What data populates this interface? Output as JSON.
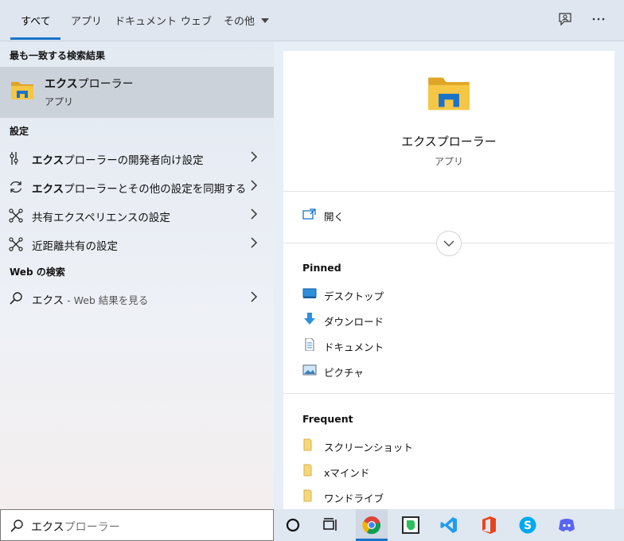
{
  "tabs": [
    {
      "label": "すべて"
    },
    {
      "label": "アプリ"
    },
    {
      "label": "ドキュメント"
    },
    {
      "label": "ウェブ"
    },
    {
      "label": "その他"
    }
  ],
  "left": {
    "best_match_heading": "最も一致する検索結果",
    "best_match": {
      "title_bold": "エクス",
      "title_rest": "プローラー",
      "subtitle": "アプリ"
    },
    "settings_heading": "設定",
    "settings": [
      {
        "bold": "エクス",
        "rest": "プローラーの開発者向け設定"
      },
      {
        "bold": "エクス",
        "rest": "プローラーとその他の設定を同期する"
      },
      {
        "bold": "",
        "rest": "共有エクスペリエンスの設定"
      },
      {
        "bold": "",
        "rest": "近距離共有の設定"
      }
    ],
    "web_heading": "Web の検索",
    "web": {
      "query": "エクス",
      "suffix": " - Web 結果を見る"
    }
  },
  "right": {
    "app_title": "エクスプローラー",
    "app_subtitle": "アプリ",
    "open_label": "開く",
    "pinned_heading": "Pinned",
    "pinned": [
      {
        "label": "デスクトップ",
        "icon": "desktop-icon"
      },
      {
        "label": "ダウンロード",
        "icon": "download-icon"
      },
      {
        "label": "ドキュメント",
        "icon": "document-icon"
      },
      {
        "label": "ピクチャ",
        "icon": "pictures-icon"
      }
    ],
    "frequent_heading": "Frequent",
    "frequent": [
      {
        "label": "スクリーンショット",
        "icon": "folder-icon"
      },
      {
        "label": "xマインド",
        "icon": "folder-icon"
      },
      {
        "label": "ワンドライブ",
        "icon": "folder-icon"
      }
    ]
  },
  "search": {
    "typed": "エクス",
    "completion": "プローラー"
  },
  "colors": {
    "accent": "#1a73c9",
    "folder": "#f6c744",
    "folder_dark": "#e0a526"
  }
}
